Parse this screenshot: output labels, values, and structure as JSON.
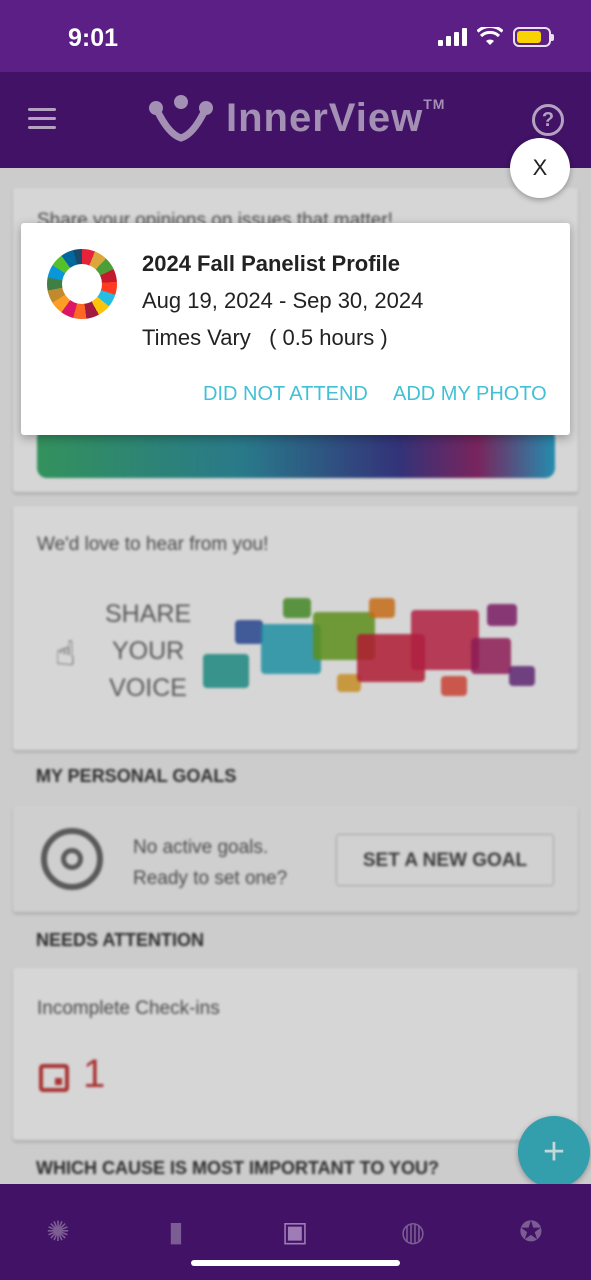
{
  "status_bar": {
    "time": "9:01"
  },
  "app_bar": {
    "brand": "InnerView",
    "trademark": "TM",
    "help_glyph": "?"
  },
  "background_feed": {
    "promo_card": {
      "text": "Share your opinions on issues that matter!"
    },
    "feedback_card": {
      "text": "We'd love to hear from you!",
      "share_line1": "SHARE",
      "share_line2": "YOUR",
      "share_line3": "VOICE"
    },
    "goals": {
      "section_title": "MY PERSONAL GOALS",
      "line1": "No active goals.",
      "line2": "Ready to set one?",
      "button": "SET A NEW GOAL"
    },
    "attention": {
      "section_title": "NEEDS ATTENTION",
      "item_label": "Incomplete Check-ins",
      "count": "1"
    },
    "cause": {
      "section_title": "WHICH CAUSE IS MOST IMPORTANT TO YOU?"
    }
  },
  "fab": {
    "glyph": "+"
  },
  "close_button": {
    "label": "X"
  },
  "event_modal": {
    "title": "2024 Fall Panelist Profile",
    "dates": "Aug 19, 2024 - Sep 30, 2024",
    "times": "Times Vary   ( 0.5 hours )",
    "actions": {
      "did_not_attend": "DID NOT ATTEND",
      "add_photo": "ADD MY PHOTO"
    }
  },
  "bottom_nav": {
    "tabs": [
      {
        "icon": "brain-icon",
        "glyph": "✺"
      },
      {
        "icon": "bar-chart-icon",
        "glyph": "▮"
      },
      {
        "icon": "folder-add-icon",
        "glyph": "▣"
      },
      {
        "icon": "globe-icon",
        "glyph": "◍"
      },
      {
        "icon": "star-badge-icon",
        "glyph": "✪"
      }
    ]
  },
  "colors": {
    "app_bar": "#4a1574",
    "status_bar": "#5b1f86",
    "accent": "#41c0d6",
    "alert": "#c23a3a"
  }
}
